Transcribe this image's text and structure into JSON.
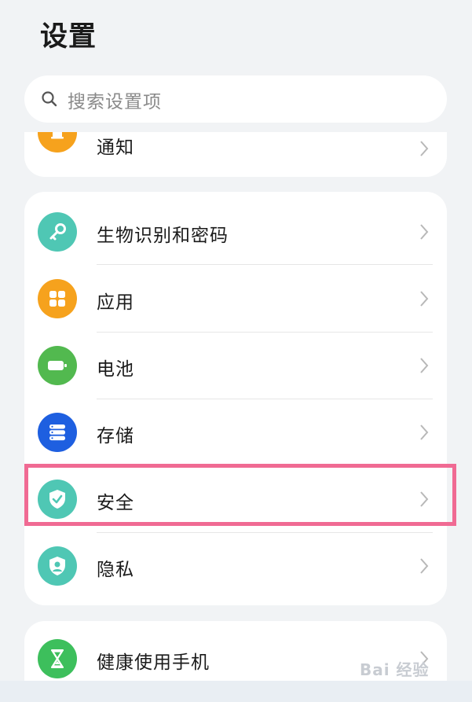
{
  "header": {
    "title": "设置"
  },
  "search": {
    "placeholder": "搜索设置项"
  },
  "items": {
    "notify": {
      "label": "通知",
      "icon": "bell-icon",
      "color": "#f6a21d"
    },
    "bio": {
      "label": "生物识别和密码",
      "icon": "key-icon",
      "color": "#4fc7b4"
    },
    "apps": {
      "label": "应用",
      "icon": "apps-grid-icon",
      "color": "#f6a21d"
    },
    "battery": {
      "label": "电池",
      "icon": "battery-icon",
      "color": "#52b94f"
    },
    "storage": {
      "label": "存储",
      "icon": "storage-icon",
      "color": "#1e5fe0"
    },
    "security": {
      "label": "安全",
      "icon": "shield-check-icon",
      "color": "#4fc7b4"
    },
    "privacy": {
      "label": "隐私",
      "icon": "privacy-shield-icon",
      "color": "#4fc7b4"
    },
    "health": {
      "label": "健康使用手机",
      "icon": "hourglass-icon",
      "color": "#3dbf5c"
    }
  },
  "watermark": {
    "text": "Bai 经验"
  }
}
